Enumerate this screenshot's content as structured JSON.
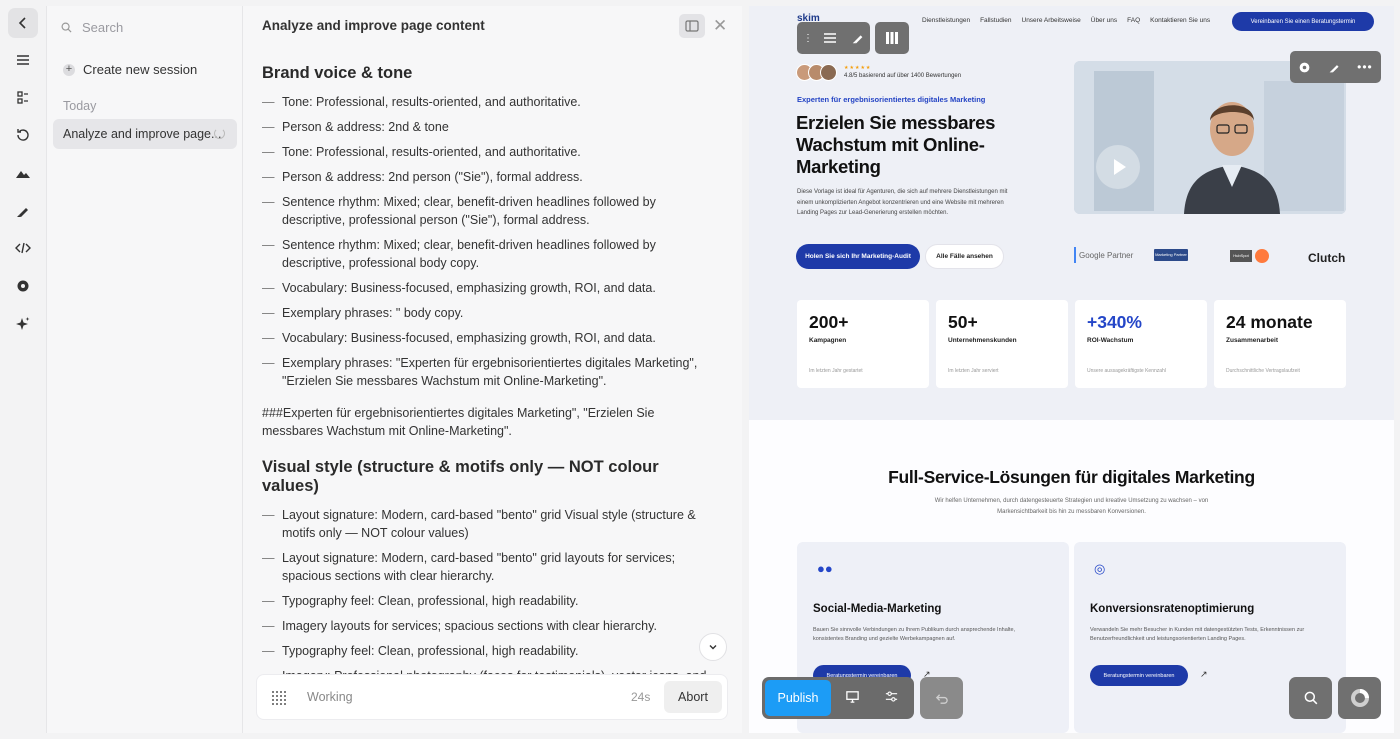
{
  "sessions": {
    "search_placeholder": "Search",
    "create_label": "Create new session",
    "group_label": "Today",
    "items": [
      {
        "label": "Analyze and improve page..."
      }
    ]
  },
  "chat": {
    "title": "Analyze and improve page content",
    "heading1": "Brand voice & tone",
    "list1": [
      "Tone: Professional, results-oriented, and authoritative.",
      "Person & address: 2nd & tone",
      "Tone: Professional, results-oriented, and authoritative.",
      "Person & address: 2nd person (\"Sie\"), formal address.",
      "Sentence rhythm: Mixed; clear, benefit-driven headlines followed by descriptive, professional person (\"Sie\"), formal address.",
      "Sentence rhythm: Mixed; clear, benefit-driven headlines followed by descriptive, professional body copy.",
      "Vocabulary: Business-focused, emphasizing growth, ROI, and data.",
      "Exemplary phrases: \" body copy.",
      "Vocabulary: Business-focused, emphasizing growth, ROI, and data.",
      "Exemplary phrases: \"Experten für ergebnisorientiertes digitales Marketing\", \"Erzielen Sie messbares Wachstum mit Online-Marketing\"."
    ],
    "paragraph": "###Experten für ergebnisorientiertes digitales Marketing\", \"Erzielen Sie messbares Wachstum mit Online-Marketing\".",
    "heading2": "Visual style (structure & motifs only — NOT colour values)",
    "list2": [
      "Layout signature: Modern, card-based \"bento\" grid Visual style (structure & motifs only — NOT colour values)",
      "Layout signature: Modern, card-based \"bento\" grid layouts for services; spacious sections with clear hierarchy.",
      "Typography feel: Clean, professional, high readability.",
      "Imagery layouts for services; spacious sections with clear hierarchy.",
      "Typography feel: Clean, professional, high readability.",
      "Imagery: Professional photography (faces for testimonials), vector icons, and"
    ],
    "status_label": "Working",
    "timer": "24s",
    "abort_label": "Abort"
  },
  "preview": {
    "nav": {
      "logo": "skim",
      "links": [
        "Dienstleistungen",
        "Fallstudien",
        "Unsere Arbeitsweise",
        "Über uns",
        "FAQ",
        "Kontaktieren Sie uns"
      ],
      "cta": "Vereinbaren Sie einen Beratungstermin"
    },
    "stars": "★★★★★",
    "rating": "4.8/5 basierend auf über 1400 Bewertungen",
    "eyebrow": "Experten für ergebnisorientiertes digitales Marketing",
    "title": "Erzielen Sie messbares Wachstum mit Online-Marketing",
    "description": "Diese Vorlage ist ideal für Agenturen, die sich auf mehrere Dienstleistungen mit einem unkomplizierten Angebot konzentrieren und eine Website mit mehreren Landing Pages zur Lead-Generierung erstellen möchten.",
    "primary_cta": "Holen Sie sich Ihr Marketing-Audit",
    "secondary_cta": "Alle Fälle ansehen",
    "logos": [
      "Google Partner",
      "Marketing Partner",
      "HubSpot",
      "Clutch"
    ],
    "stats": [
      {
        "value": "200+",
        "label": "Kampagnen",
        "note": "Im letzten Jahr gestartet"
      },
      {
        "value": "50+",
        "label": "Unternehmenskunden",
        "note": "Im letzten Jahr serviert"
      },
      {
        "value": "+340%",
        "label": "ROI-Wachstum",
        "note": "Unsere aussagekräftigste Kennzahl"
      },
      {
        "value": "24 monate",
        "label": "Zusammenarbeit",
        "note": "Durchschnittliche Vertragslaufzeit"
      }
    ],
    "section_title": "Full-Service-Lösungen für digitales Marketing",
    "section_subtitle": "Wir helfen Unternehmen, durch datengesteuerte Strategien und kreative Umsetzung zu wachsen – von Markensichtbarkeit bis hin zu messbaren Konversionen.",
    "services": [
      {
        "title": "Social-Media-Marketing",
        "text": "Bauen Sie sinnvolle Verbindungen zu Ihrem Publikum durch ansprechende Inhalte, konsistentes Branding und gezielte Werbekampagnen auf.",
        "cta": "Beratungstermin vereinbaren"
      },
      {
        "title": "Konversionsratenoptimierung",
        "text": "Verwandeln Sie mehr Besucher in Kunden mit datengestützten Tests, Erkenntnissen zur Benutzerfreundlichkeit und leistungsorientierten Landing Pages.",
        "cta": "Beratungstermin vereinbaren"
      }
    ]
  },
  "overlay": {
    "publish_label": "Publish"
  },
  "colors": {
    "brand_blue": "#1e3aa8",
    "accent_blue": "#2446c8",
    "publish_blue": "#1c9cf6"
  }
}
